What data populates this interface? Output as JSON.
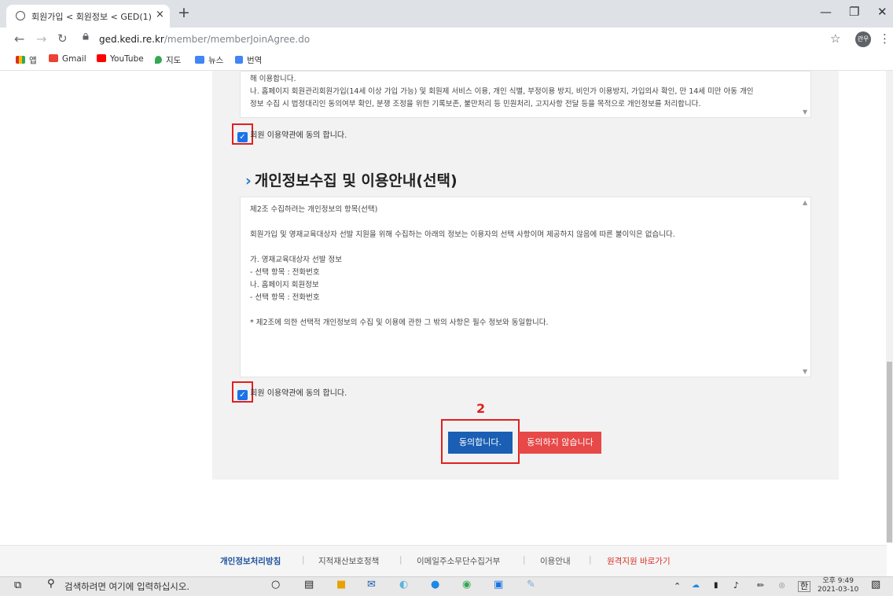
{
  "browser": {
    "tab_title": "회원가입 < 회원정보 < GED(1)",
    "tab_close": "×",
    "new_tab": "+",
    "url_host": "ged.kedi.re.kr",
    "url_path": "/member/memberJoinAgree.do",
    "profile_initial": "관우",
    "bookmarks": [
      {
        "label": "앱",
        "color": "#d93025"
      },
      {
        "label": "Gmail",
        "color": "#ea4335"
      },
      {
        "label": "YouTube",
        "color": "#ff0000"
      },
      {
        "label": "지도",
        "color": "#34a853"
      },
      {
        "label": "뉴스",
        "color": "#4285f4"
      },
      {
        "label": "번역",
        "color": "#4285f4"
      }
    ]
  },
  "terms1": {
    "line1": "해 이용합니다.",
    "line2": "나. 홈페이지 회원관리회원가입(14세 이상 가입 가능) 및 회원제 서비스 이용, 개인 식별, 부정이용 방지, 비인가 이용방지, 가입의사 확인, 만 14세 미만 아동 개인",
    "line3": "정보 수집 시 법정대리인 동의여부 확인, 분쟁 조정을 위한 기록보존, 불만처리 등 민원처리, 고지사항 전달 등을 목적으로 개인정보를 처리합니다.",
    "agree_label": "회원 이용약관에 동의 합니다."
  },
  "section": {
    "title": "개인정보수집 및 이용안내(선택)"
  },
  "terms2": {
    "lines": [
      "제2조 수집하려는 개인정보의 항목(선택)",
      "",
      "회원가입 및 영재교육대상자 선발 지원을 위해 수집하는 아래의 정보는 이용자의 선택 사항이며 제공하지 않음에 따른 불이익은 없습니다.",
      "",
      "가. 영재교육대상자 선발 정보",
      "- 선택 항목 : 전화번호",
      "나. 홈페이지 회원정보",
      "- 선택 항목 : 전화번호",
      "",
      "* 제2조에 의한 선택적 개인정보의 수집 및 이용에 관한 그 밖의 사항은 필수 정보와 동일합니다."
    ],
    "agree_label": "회원 이용약관에 동의 합니다."
  },
  "annotation": {
    "step": "2"
  },
  "buttons": {
    "agree": "동의합니다.",
    "disagree": "동의하지 않습니다"
  },
  "footer": {
    "links": [
      "개인정보처리방침",
      "지적재산보호정책",
      "이메일주소무단수집거부",
      "이용안내",
      "원격지원 바로가기"
    ],
    "separator": "|"
  },
  "taskbar": {
    "search_placeholder": "검색하려면 여기에 입력하십시오.",
    "time": "오후 9:49",
    "date": "2021-03-10",
    "ime": "한"
  }
}
